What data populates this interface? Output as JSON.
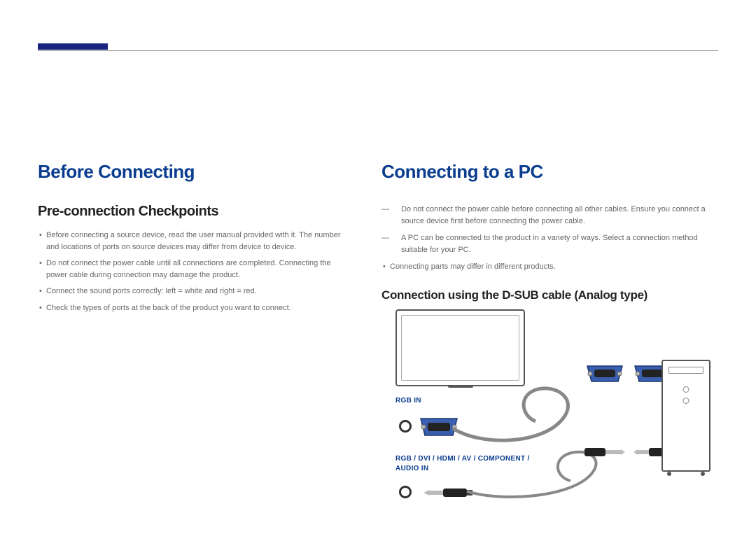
{
  "left": {
    "heading": "Before Connecting",
    "subheading": "Pre-connection Checkpoints",
    "bullets": [
      "Before connecting a source device, read the user manual provided with it. The number and locations of ports on source devices may differ from device to device.",
      "Do not connect the power cable until all connections are completed. Connecting the power cable during connection may damage the product.",
      "Connect the sound ports correctly: left = white and right = red.",
      "Check the types of ports at the back of the product you want to connect."
    ]
  },
  "right": {
    "heading": "Connecting to a PC",
    "notes": [
      {
        "label": "―",
        "text": "Do not connect the power cable before connecting all other cables. Ensure you connect a source device first before connecting the power cable."
      },
      {
        "label": "―",
        "text": "A PC can be connected to the product in a variety of ways. Select a connection method suitable for your PC."
      }
    ],
    "bullets": [
      "Connecting parts may differ in different products."
    ],
    "subheading": "Connection using the D-SUB cable (Analog type)",
    "diagram": {
      "label_rgb": "RGB IN",
      "label_audio": "RGB / DVI / HDMI / AV / COMPONENT / AUDIO IN"
    }
  }
}
